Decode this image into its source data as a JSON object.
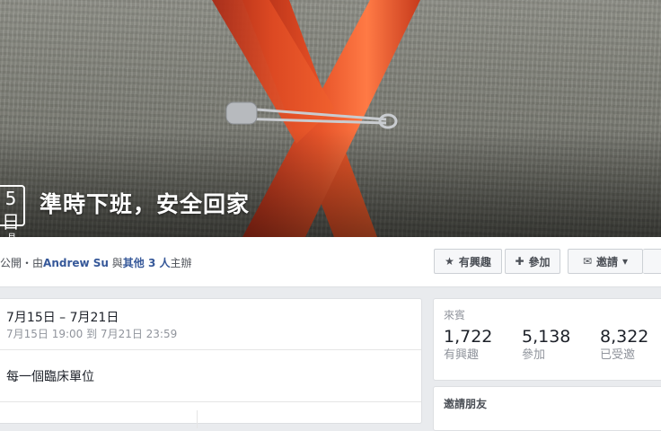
{
  "cover": {
    "date_day": "5日",
    "date_month": "月",
    "title": "準時下班，安全回家"
  },
  "header": {
    "privacy": "公開",
    "by_prefix": "・由",
    "host": "Andrew Su",
    "and": " 與",
    "others": "其他 3 人",
    "hosted": "主辦",
    "interested_label": "有興趣",
    "join_label": "參加",
    "invite_label": "邀請"
  },
  "details": {
    "date_range": "7月15日 – 7月21日",
    "date_detail": "7月15日 19:00 到 7月21日 23:59",
    "location": "每一個臨床單位"
  },
  "guests": {
    "heading": "來賓",
    "stats": [
      {
        "value": "1,722",
        "label": "有興趣"
      },
      {
        "value": "5,138",
        "label": "參加"
      },
      {
        "value": "8,322",
        "label": "已受邀"
      }
    ]
  },
  "invite_friends": {
    "heading": "邀請朋友"
  },
  "icons": {
    "interested": "star-icon",
    "join": "plus-icon",
    "invite": "envelope-icon",
    "dropdown": "caret-down-icon"
  },
  "colors": {
    "ribbon": "#d4431f",
    "link": "#365899",
    "page_bg": "#e9ebee"
  }
}
